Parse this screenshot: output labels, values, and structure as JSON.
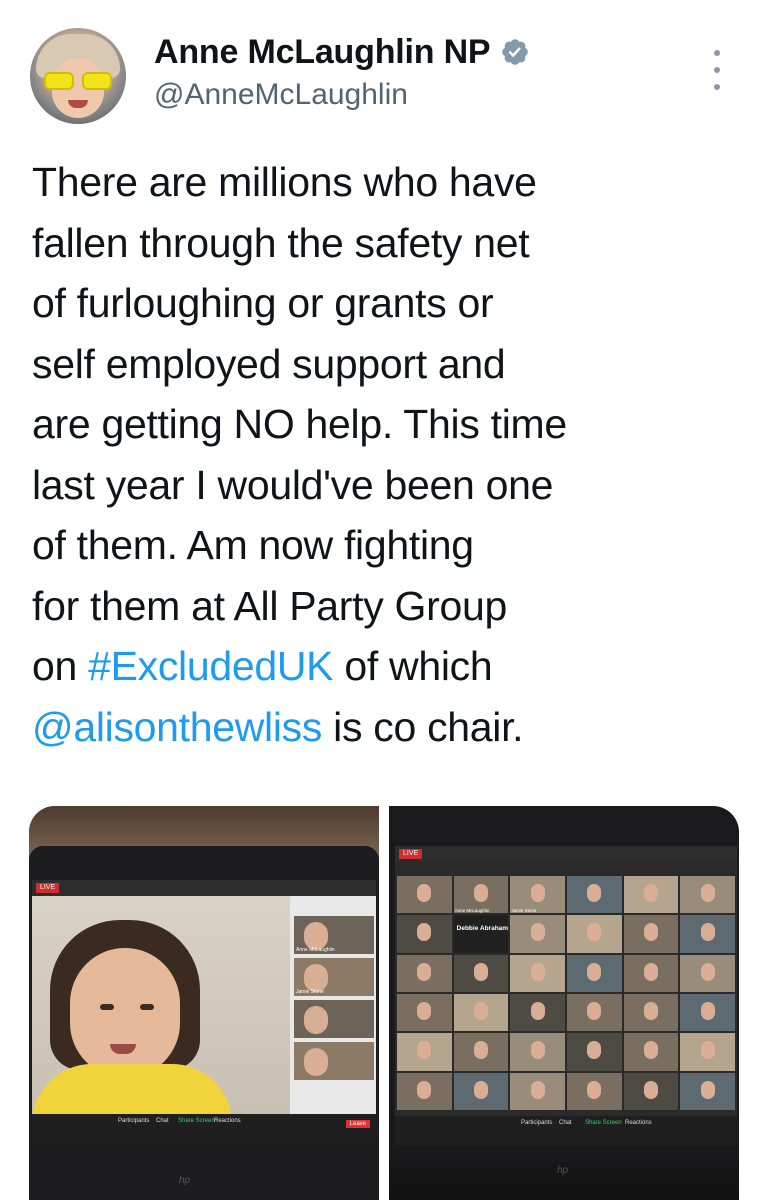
{
  "author": {
    "display_name": "Anne McLaughlin NP",
    "handle": "@AnneMcLaughlin",
    "verified_icon": "verified-badge-icon",
    "colors": {
      "link": "#1d9bf0",
      "secondary": "#536471",
      "text": "#0f1419"
    }
  },
  "tweet": {
    "lines": [
      "There are millions who have",
      "fallen through the safety net",
      "of furloughing or grants or",
      "self employed support and",
      "are getting NO help. This time",
      "last year I would've been one",
      "of them. Am now fighting",
      "for them at All Party Group"
    ],
    "line9_pre": "on ",
    "hashtag": "#ExcludedUK",
    "line9_post": " of which",
    "mention": "@alisonthewliss",
    "line10_post": " is co chair."
  },
  "media_left": {
    "live": "LIVE",
    "tiles": [
      "Anne McLaughlin",
      "Jamie Stone",
      "",
      "",
      "",
      ""
    ],
    "toolbar": [
      "Participants",
      "Chat",
      "Share Screen",
      "Reactions"
    ],
    "leave": "Leave"
  },
  "media_right": {
    "live": "LIVE",
    "debbie": "Debbie Abrahams",
    "toolbar": [
      "Participants",
      "Chat",
      "Share Screen",
      "Reactions"
    ],
    "captions": [
      "",
      "Anne McLaughlin",
      "Jamie Stone",
      "",
      "",
      "",
      "",
      "",
      "",
      "",
      "",
      "",
      "",
      "",
      "",
      "",
      "",
      "",
      "",
      "",
      "",
      "",
      "",
      "",
      "",
      "",
      "",
      "",
      "",
      "",
      "",
      "",
      "",
      "",
      "",
      ""
    ]
  }
}
